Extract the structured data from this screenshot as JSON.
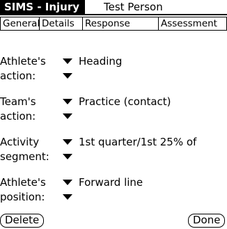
{
  "header": {
    "app_title": "SIMS - Injury",
    "record_title": "Test Person"
  },
  "tabs": [
    {
      "label": "General",
      "active": false
    },
    {
      "label": "Details",
      "active": true
    },
    {
      "label": "Response",
      "active": false
    },
    {
      "label": "Assessment",
      "active": false
    }
  ],
  "fields": [
    {
      "label_line1": "Athlete's",
      "label_line2": "action:",
      "value1": "Heading",
      "value2": ""
    },
    {
      "label_line1": "Team's",
      "label_line2": "action:",
      "value1": "Practice (contact)",
      "value2": ""
    },
    {
      "label_line1": "Activity",
      "label_line2": "segment:",
      "value1": "1st quarter/1st 25% of",
      "value2": ""
    },
    {
      "label_line1": "Athlete's",
      "label_line2": "position:",
      "value1": "Forward line",
      "value2": ""
    }
  ],
  "footer": {
    "delete_label": "Delete",
    "done_label": "Done"
  }
}
